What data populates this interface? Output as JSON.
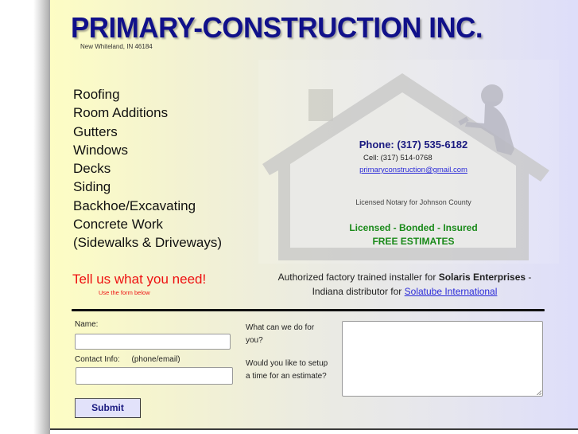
{
  "header": {
    "company_name": "PRIMARY-CONSTRUCTION INC.",
    "address": "New Whiteland, IN 46184"
  },
  "services": [
    "Roofing",
    "Room Additions",
    "Gutters",
    "Windows",
    "Decks",
    "Siding",
    "Backhoe/Excavating",
    "Concrete Work",
    "(Sidewalks & Driveways)"
  ],
  "contact": {
    "phone": "Phone: (317) 535-6182",
    "cell": "Cell:  (317) 514-0768",
    "email": "primaryconstruction@gmail.com",
    "notary": "Licensed Notary for Johnson County",
    "credentials": "Licensed - Bonded - Insured",
    "free_estimates": "FREE ESTIMATES"
  },
  "background_graphic": {
    "icon": "house-with-roofer-silhouette"
  },
  "call_to_action": {
    "headline": "Tell us what you need!",
    "subtext": "Use the form below"
  },
  "authorized": {
    "prefix": "Authorized factory trained installer for ",
    "company": "Solaris Enterprises",
    "suffix": " -",
    "line2_prefix": "Indiana distributor for ",
    "link_text": "Solatube International "
  },
  "form": {
    "name_label": "Name:",
    "name_value": "",
    "contact_label": "Contact Info:",
    "contact_hint": "(phone/email)",
    "contact_value": "",
    "message_label_1": "What can we do for",
    "message_label_2": "you?",
    "estimate_label_1": "Would you like to setup",
    "estimate_label_2": "a time for an estimate?",
    "message_value": "",
    "submit_label": "Submit"
  },
  "colors": {
    "brand_blue": "#10108a",
    "accent_red": "#ee1111",
    "accent_green": "#1a8a1a",
    "link_blue": "#2b2bd8"
  }
}
